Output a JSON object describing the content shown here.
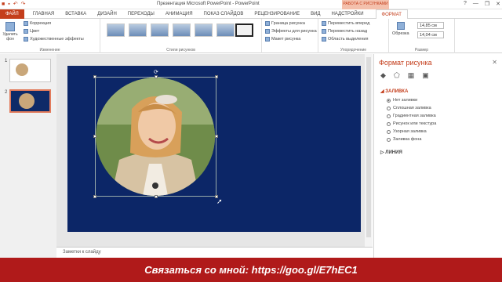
{
  "window": {
    "title": "Презентация Microsoft PowerPoint - PowerPoint",
    "context_header": "РАБОТА С РИСУНКАМИ",
    "controls": [
      "?",
      "—",
      "❐",
      "✕"
    ]
  },
  "tabs": [
    "ФАЙЛ",
    "ГЛАВНАЯ",
    "ВСТАВКА",
    "ДИЗАЙН",
    "ПЕРЕХОДЫ",
    "АНИМАЦИЯ",
    "ПОКАЗ СЛАЙДОВ",
    "РЕЦЕНЗИРОВАНИЕ",
    "ВИД",
    "НАДСТРОЙКИ",
    "ФОРМАТ"
  ],
  "ribbon": {
    "remove_bg": "Удалить фон",
    "correction": "Коррекция",
    "color": "Цвет",
    "artistic": "Художественные эффекты",
    "group_change": "Изменение",
    "group_styles": "Стили рисунков",
    "border": "Граница рисунка",
    "effects": "Эффекты для рисунка",
    "layout": "Макет рисунка",
    "bring_forward": "Переместить вперед",
    "send_backward": "Переместить назад",
    "selection_pane": "Область выделения",
    "group_arrange": "Упорядочение",
    "crop": "Обрезка",
    "height": "14,85 см",
    "width": "14,04 см",
    "group_size": "Размер"
  },
  "slides": [
    {
      "num": "1"
    },
    {
      "num": "2"
    }
  ],
  "notes": "Заметки к слайду",
  "format_pane": {
    "title": "Формат рисунка",
    "fill_header": "ЗАЛИВКА",
    "fill_options": [
      "Нет заливки",
      "Сплошная заливка",
      "Градиентная заливка",
      "Рисунок или текстура",
      "Узорная заливка",
      "Заливка фона"
    ],
    "line_header": "ЛИНИЯ"
  },
  "banner": "Связаться со мной: https://goo.gl/E7hEC1",
  "colors": {
    "accent": "#c43e1c",
    "slide_bg": "#0c2667",
    "banner": "#b01a1a"
  }
}
